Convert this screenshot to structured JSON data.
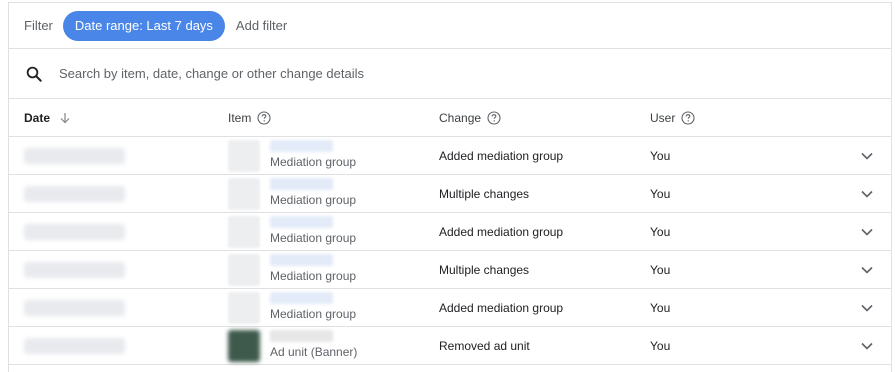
{
  "filter": {
    "label": "Filter",
    "active_chip": "Date range: Last 7 days",
    "add_filter": "Add filter"
  },
  "search": {
    "icon": "search-icon",
    "placeholder": "Search by item, date, change or other change details"
  },
  "table": {
    "columns": {
      "date": "Date",
      "item": "Item",
      "change": "Change",
      "user": "User"
    },
    "sort": {
      "column": "Date",
      "direction": "descending"
    },
    "rows": [
      {
        "date": "",
        "item_name": "",
        "item_type": "Mediation group",
        "change": "Added mediation group",
        "user": "You"
      },
      {
        "date": "",
        "item_name": "",
        "item_type": "Mediation group",
        "change": "Multiple changes",
        "user": "You"
      },
      {
        "date": "",
        "item_name": "",
        "item_type": "Mediation group",
        "change": "Added mediation group",
        "user": "You"
      },
      {
        "date": "",
        "item_name": "",
        "item_type": "Mediation group",
        "change": "Multiple changes",
        "user": "You"
      },
      {
        "date": "",
        "item_name": "",
        "item_type": "Mediation group",
        "change": "Added mediation group",
        "user": "You"
      },
      {
        "date": "",
        "item_name": "",
        "item_type": "Ad unit (Banner)",
        "change": "Removed ad unit",
        "user": "You"
      }
    ]
  },
  "colors": {
    "accent": "#4a86e8",
    "text": "#202124",
    "secondary_text": "#5f6368",
    "divider": "#e0e0e0"
  }
}
